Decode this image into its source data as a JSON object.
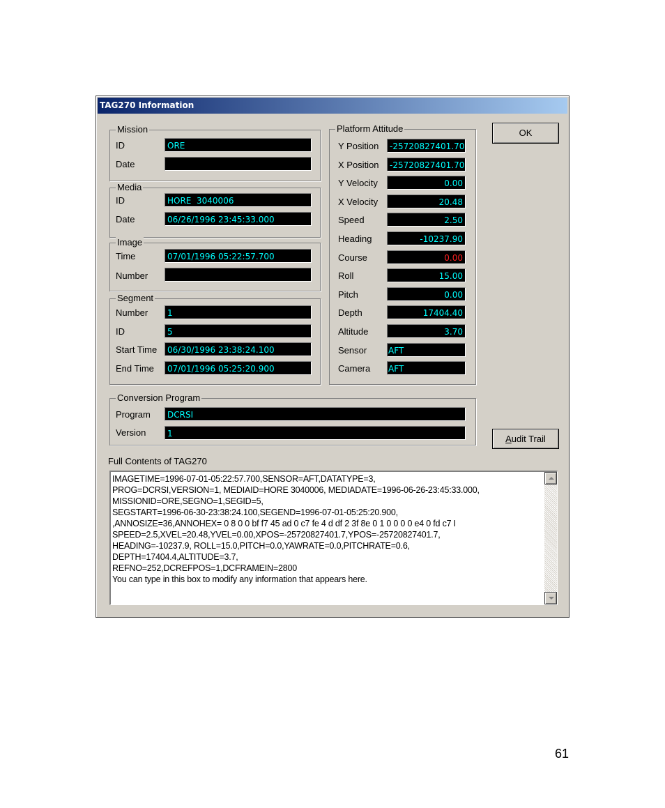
{
  "dialog": {
    "title": "TAG270 Information",
    "ok_label": "OK",
    "audit_label": "Audit Trail",
    "mission": {
      "legend": "Mission",
      "id_label": "ID",
      "id_value": "ORE",
      "date_label": "Date",
      "date_value": ""
    },
    "media": {
      "legend": "Media",
      "id_label": "ID",
      "id_value": "HORE  3040006",
      "date_label": "Date",
      "date_value": "06/26/1996 23:45:33.000"
    },
    "image": {
      "legend": "Image",
      "time_label": "Time",
      "time_value": "07/01/1996 05:22:57.700",
      "number_label": "Number",
      "number_value": ""
    },
    "segment": {
      "legend": "Segment",
      "number_label": "Number",
      "number_value": "1",
      "id_label": "ID",
      "id_value": "5",
      "start_label": "Start Time",
      "start_value": "06/30/1996 23:38:24.100",
      "end_label": "End Time",
      "end_value": "07/01/1996 05:25:20.900"
    },
    "platform": {
      "legend": "Platform Attitude",
      "rows": [
        {
          "label": "Y Position",
          "value": "-25720827401.70"
        },
        {
          "label": "X Position",
          "value": "-25720827401.70"
        },
        {
          "label": "Y Velocity",
          "value": "0.00"
        },
        {
          "label": "X Velocity",
          "value": "20.48"
        },
        {
          "label": "Speed",
          "value": "2.50"
        },
        {
          "label": "Heading",
          "value": "-10237.90"
        },
        {
          "label": "Course",
          "value": "0.00"
        },
        {
          "label": "Roll",
          "value": "15.00"
        },
        {
          "label": "Pitch",
          "value": "0.00"
        },
        {
          "label": "Depth",
          "value": "17404.40"
        },
        {
          "label": "Altitude",
          "value": "3.70"
        },
        {
          "label": "Sensor",
          "value": "AFT"
        },
        {
          "label": "Camera",
          "value": "AFT"
        }
      ]
    },
    "conversion": {
      "legend": "Conversion Program",
      "program_label": "Program",
      "program_value": "DCRSI",
      "version_label": "Version",
      "version_value": "1"
    },
    "full_contents_label": "Full Contents of TAG270",
    "full_contents_lines": [
      "IMAGETIME=1996-07-01-05:22:57.700,SENSOR=AFT,DATATYPE=3,",
      "PROG=DCRSI,VERSION=1, MEDIAID=HORE  3040006, MEDIADATE=1996-06-26-23:45:33.000,",
      "MISSIONID=ORE,SEGNO=1,SEGID=5,",
      "SEGSTART=1996-06-30-23:38:24.100,SEGEND=1996-07-01-05:25:20.900,",
      ",ANNOSIZE=36,ANNOHEX=  0  8  0  0 bf f7 45 ad  0 c7 fe  4  d df  2 3f 8e  0  1  0  0  0  0 e4  0 fd c7  I",
      "SPEED=2.5,XVEL=20.48,YVEL=0.00,XPOS=-25720827401.7,YPOS=-25720827401.7,",
      "HEADING=-10237.9, ROLL=15.0,PITCH=0.0,YAWRATE=0.0,PITCHRATE=0.6,",
      "DEPTH=17404.4,ALTITUDE=3.7,",
      "REFNO=252,DCREFPOS=1,DCFRAMEIN=2800",
      "You can type in this box to modify any information that appears here."
    ]
  },
  "page_number": "61",
  "colors": {
    "field_bg": "#000000",
    "field_text": "#00ffff",
    "field_alert": "#ff2020",
    "dialog_bg": "#d4d0c8"
  }
}
